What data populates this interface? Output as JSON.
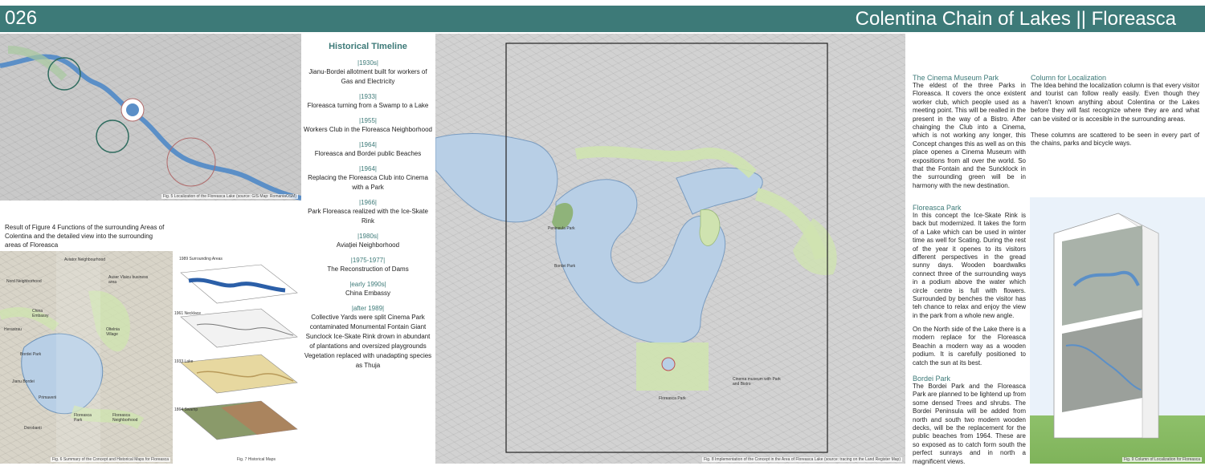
{
  "header": {
    "number": "026",
    "title": "Colentina Chain of Lakes || Floreasca"
  },
  "fig5": {
    "caption": "Fig. 5 Localization of the Floreasca Lake (source: GIS Map: RomaniaOSM)"
  },
  "result_text": "Result of Figure 4 Functions of the surrounding Areas of Colentina and the detailed view into the surrounding areas of Floreasca",
  "fig6": {
    "caption": "Fig. 6 Summary of the Concept and Historical Maps for Floreasca",
    "labels": [
      "Aviator Neighbourhood",
      "Nord Neighborhood",
      "Auser Vlaicu business area",
      "China Embassy",
      "Herastrau",
      "Oltelnia Village",
      "Bordei Park",
      "Jianu Bordei",
      "Primaverii",
      "Floreasca Park",
      "Floreasca Neighborhood",
      "Dorobanti"
    ]
  },
  "fig7": {
    "caption": "Fig. 7 Historical Maps",
    "layers": [
      "1989 Surrounding Areas",
      "1961 Necklace",
      "1933 Lake",
      "1864 Swamp"
    ]
  },
  "timeline": {
    "heading": "Historical TImeline",
    "entries": [
      {
        "year": "|1930s|",
        "text": "Jianu-Bordei allotment built for workers of Gas and Electricity"
      },
      {
        "year": "|1933|",
        "text": "Floreasca turning from a Swamp to a Lake"
      },
      {
        "year": "|1955|",
        "text": "Workers Club in the Floreasca Neighborhood"
      },
      {
        "year": "|1964|",
        "text": "Floreasca and Bordei public Beaches"
      },
      {
        "year": "|1964|",
        "text": "Replacing the Floreasca Club into Cinema with a Park"
      },
      {
        "year": "|1966|",
        "text": "Park Floreasca realized with the Ice-Skate Rink"
      },
      {
        "year": "|1980s|",
        "text": "Aviaţiei Neighborhood"
      },
      {
        "year": "|1975-1977|",
        "text": "The Reconstruction of Dams"
      },
      {
        "year": "|early 1990s|",
        "text": "China Embassy"
      },
      {
        "year": "|after 1989|",
        "text": "Collective Yards were split Cinema Park contaminated Monumental Fontain Giant Sunclock Ice-Skate Rink drown in abundant of plantations and oversized playgrounds Vegetation replaced with unadapting species as Thuja"
      }
    ]
  },
  "fig8": {
    "caption": "Fig. 8 Implementation of the Concept in the Area of Floreasca Lake (source: tracing on the Land Register Map)",
    "labels": [
      "Bordei Park",
      "Floreasca Park",
      "Peninsula Park",
      "Cinema museum with Park and Bistro"
    ]
  },
  "cinema": {
    "title": "The Cinema Museum Park",
    "text": "The eldest of the three Parks in Floreasca. It covers the once existent worker club, which people used as a meeting point. This will be realled in the present in the way of a Bistro. After chainging the Club into a Cinema, which is not working any longer, this Concept changes this as well as on this place openes a Cinema Museum with expositions from all over the world. So that the Fontain and the Suncklock in the surrounding green will be in harmony with the new destination."
  },
  "floreasca_park": {
    "title": "Floreasca Park",
    "text": "In this concept the Ice-Skate Rink is back but modernized. It takes the form of a Lake which can be used in winter time as well for Scating. During the rest of the year it openes to its visitors different perspectives in the gread sunny days. Wooden boardwalks connect three of the surrounding ways in a podium above the water which circle centre is full with flowers. Surrounded by benches the visitor has teh chance to relax and enjoy the view in the park from a whole new angle.",
    "text2": "On the North side of the Lake there is a modern replace for the Floreasca Beachin a modern way as a wooden podium. It is carefully positioned to catch the sun at its best."
  },
  "bordei_park": {
    "title": "Bordei Park",
    "text": "The Bordei Park and the Floreasca Park are planned to be lightend up from some densed Trees and shrubs. The Bordei Peninsula will be added from north and south two modern wooden decks, will be the replacement for the public beaches from 1964. These are so exposed as to catch form south the perfect sunrays and in north a magnificent views."
  },
  "column": {
    "title": "Column for Localization",
    "text": "The Idea behind the localization column is that every visitor and tourist can follow really easily. Even though they haven't known anything about Colentina or the Lakes before they will fast recognize where they are and what can be visited or is accesible in the surrounding areas.",
    "text2": "These columns are scattered to be seen in every part of the chains, parks and bicycle ways."
  },
  "fig9": {
    "caption": "Fig. 9 Column of Localization for Floreasca"
  },
  "colors": {
    "header": "#3d7a78",
    "lake": "#b8cfe6",
    "green": "#cfe3b0"
  }
}
